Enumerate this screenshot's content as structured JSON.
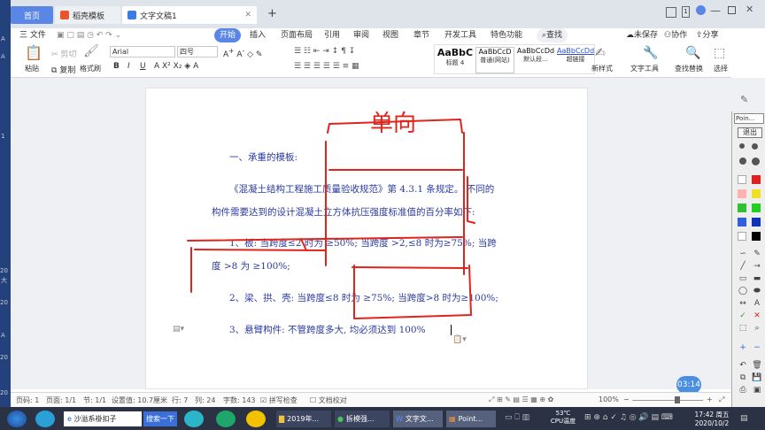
{
  "tabs": [
    {
      "label": "首页"
    },
    {
      "label": "稻壳模板"
    },
    {
      "label": "文字文稿1"
    }
  ],
  "window": {
    "add_tab": "+",
    "badge": "1"
  },
  "menu": {
    "file": "三 文件",
    "items": [
      "开始",
      "插入",
      "页面布局",
      "引用",
      "审阅",
      "视图",
      "章节",
      "开发工具",
      "特色功能"
    ],
    "search": "查找",
    "unsaved": "未保存",
    "collab": "协作",
    "share": "分享"
  },
  "ribbon": {
    "paste": "粘贴",
    "cut": "剪切",
    "copy": "复制",
    "format_painter": "格式刷",
    "font_name": "Arial",
    "font_size": "四号",
    "styles": [
      {
        "preview": "AaBbC",
        "name": "标题 4"
      },
      {
        "preview": "AaBbCcD",
        "name": "普通(网站)"
      },
      {
        "preview": "AaBbCcDd",
        "name": "默认段..."
      },
      {
        "preview": "AaBbCcDd",
        "name": "超链接"
      }
    ],
    "new_style": "新样式",
    "text_tools": "文字工具",
    "find_replace": "查找替换",
    "select": "选择"
  },
  "doc": {
    "heading": "一、承重的模板:",
    "p1a": "《混凝土结构工程施工质量验收规范》第 4.3.1 条规定。 不同的",
    "p1b": "构件需要达到的设计混凝土立方体抗压强度标准值的百分率如下:",
    "item1a": "1、板: 当跨度≤2 时为 ≥50%; 当跨度 >2,≤8 时为≥75%; 当跨",
    "item1b": "度 >8 为 ≥100%;",
    "item2": "2、梁、拱、壳: 当跨度≤8 时为 ≥75%; 当跨度>8 时为≥100%;",
    "item3": "3、悬臂构件: 不管跨度多大, 均必须达到 100%",
    "annotation": "单向"
  },
  "status": {
    "page": "页码: 1",
    "pages": "页面: 1/1",
    "section": "节: 1/1",
    "setting": "设置值: 10.7厘米",
    "row": "行: 7",
    "col": "列: 24",
    "words": "字数: 143",
    "spell": "拼写检查",
    "proof": "文档校对",
    "zoom": "100%",
    "timer": "03:14"
  },
  "pointofix": {
    "title": "Poin...",
    "exit": "退出"
  },
  "swatches": [
    "#ffffff",
    "#e02020",
    "#ffb0b0",
    "#f0e020",
    "#30c030",
    "#20d020",
    "#3060e0",
    "#1030c0",
    "#ffffff",
    "#000000"
  ],
  "taskbar": {
    "search_text": "沙溢系褂扣子",
    "search_btn": "搜索一下",
    "apps": [
      {
        "label": "2019年..."
      },
      {
        "label": "拆模强..."
      },
      {
        "label": "文字文..."
      },
      {
        "label": "Point..."
      }
    ],
    "temp": "53℃",
    "temp_label": "CPU温度",
    "time": "17:42 周五",
    "date": "2020/10/2"
  },
  "desktop_labels": [
    "A",
    "A",
    "1",
    "20",
    "大",
    "20",
    "A",
    "20",
    "20"
  ],
  "colors": {
    "accent": "#5a86e6",
    "text_blue": "#2a3aa0",
    "pen_red": "#e0241c",
    "taskbar": "#2b3244"
  }
}
